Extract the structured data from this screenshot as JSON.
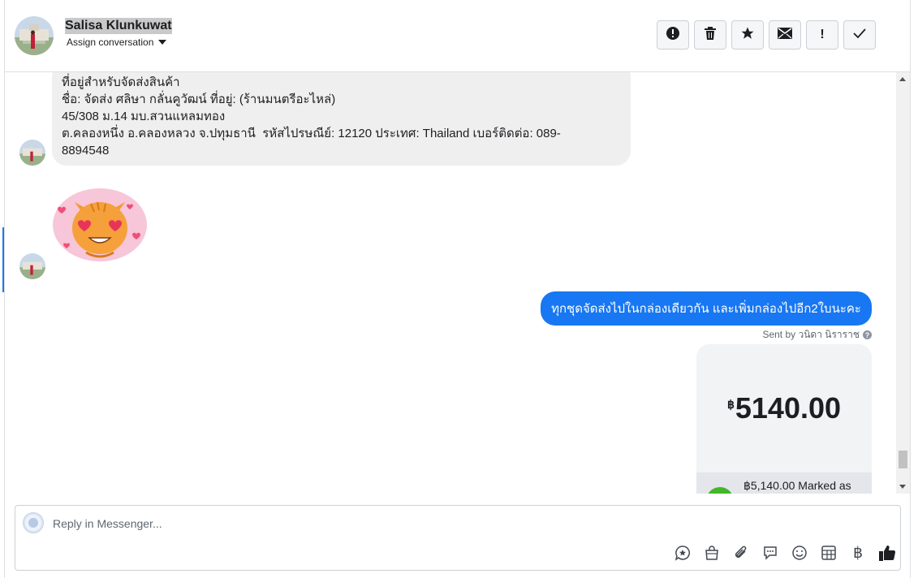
{
  "header": {
    "contact_name": "Salisa Klunkuwat",
    "assign_label": "Assign conversation",
    "actions": [
      {
        "icon": "alert-icon",
        "glyph": "!"
      },
      {
        "icon": "trash-icon",
        "glyph": ""
      },
      {
        "icon": "star-icon",
        "glyph": "★"
      },
      {
        "icon": "envelope-icon",
        "glyph": "✉"
      },
      {
        "icon": "exclamation-icon",
        "glyph": "!"
      },
      {
        "icon": "check-icon",
        "glyph": "✓"
      }
    ]
  },
  "messages": {
    "incoming_address": {
      "lines": [
        "ที่อยู่สำหรับจัดส่งสินค้า",
        "ชื่อ: จัดส่ง ศลิษา กลั่นคูวัฒน์ ที่อยู่: (ร้านมนตรีอะไหล่)",
        "45/308 ม.14 มบ.สวนแหลมทอง",
        "ต.คลองหนึ่ง อ.คลองหลวง จ.ปทุมธานี  รหัสไปรษณีย์: 12120 ประเทศ: Thailand เบอร์ติดต่อ: 089-",
        "8894548"
      ]
    },
    "sticker": {
      "icon": "cat-heart-eyes-sticker"
    },
    "outgoing": {
      "text": "ทุกชุดจัดส่งไปในกล่องเดียวกัน และเพิ่มกล่องไปอีก2ใบนะคะ",
      "sent_by": "Sent by วนิดา นิราราช"
    },
    "payment": {
      "currency": "฿",
      "amount": "5140.00",
      "status": "฿5,140.00 Marked as"
    }
  },
  "composer": {
    "placeholder": "Reply in Messenger...",
    "tools": [
      "saved-reply-icon",
      "shop-bag-icon",
      "attachment-icon",
      "chat-bubbles-icon",
      "emoji-icon",
      "table-icon",
      "baht-icon",
      "like-icon"
    ],
    "baht_glyph": "฿"
  },
  "colors": {
    "accent": "#1877f2",
    "incoming_bubble": "#efefef",
    "success": "#42b72a"
  }
}
